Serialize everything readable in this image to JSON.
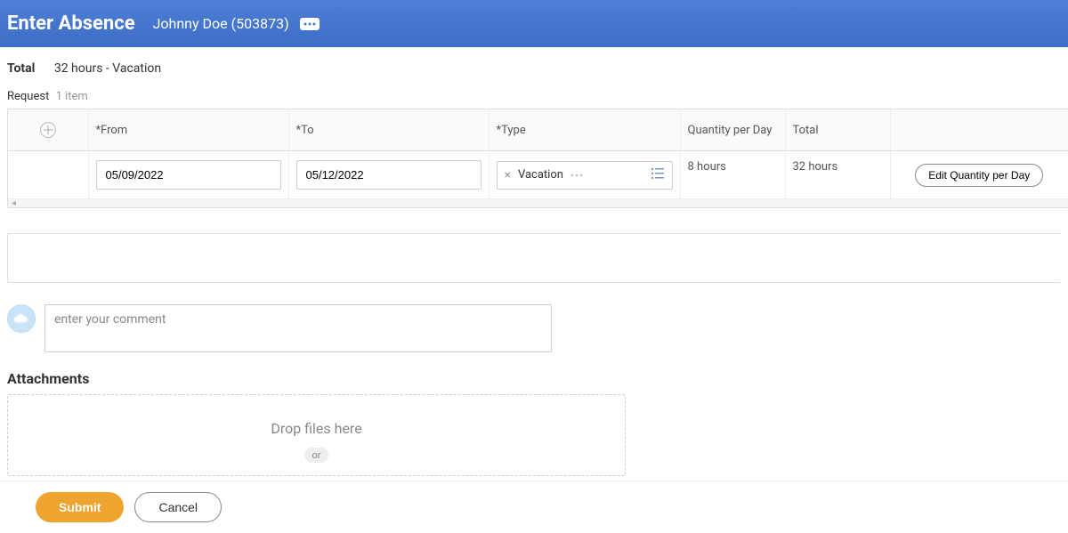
{
  "header": {
    "title": "Enter Absence",
    "subtitle": "Johnny Doe (503873)"
  },
  "summary": {
    "label": "Total",
    "value": "32 hours - Vacation"
  },
  "request": {
    "label": "Request",
    "count": "1 item"
  },
  "table": {
    "headers": {
      "from": "*From",
      "to": "*To",
      "type": "*Type",
      "qpd": "Quantity per Day",
      "total": "Total"
    },
    "row": {
      "from": "05/09/2022",
      "to": "05/12/2022",
      "type": "Vacation",
      "qpd": "8 hours",
      "total": "32 hours",
      "edit_label": "Edit Quantity per Day"
    }
  },
  "comment": {
    "placeholder": "enter your comment"
  },
  "attachments": {
    "title": "Attachments",
    "drop_text": "Drop files here",
    "or_label": "or"
  },
  "footer": {
    "submit": "Submit",
    "cancel": "Cancel"
  }
}
